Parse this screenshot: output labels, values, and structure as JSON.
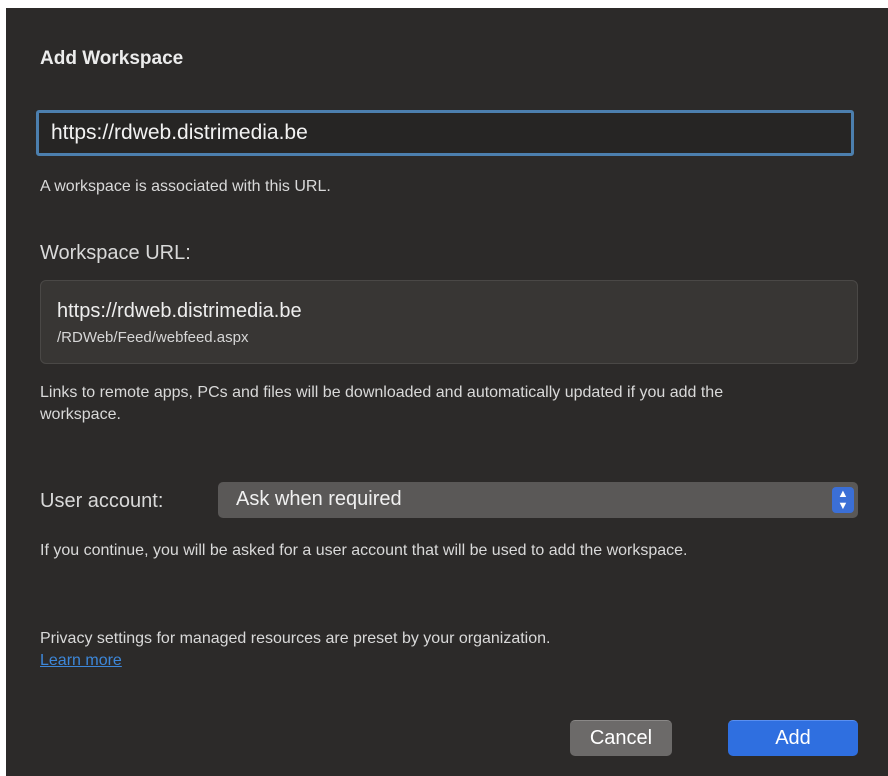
{
  "dialog": {
    "title": "Add Workspace",
    "url_input_value": "https://rdweb.distrimedia.be",
    "url_hint": "A workspace is associated with this URL.",
    "workspace_url_label": "Workspace URL:",
    "workspace_url": {
      "host": "https://rdweb.distrimedia.be",
      "path": "/RDWeb/Feed/webfeed.aspx"
    },
    "links_info": "Links to remote apps, PCs and files will be downloaded and automatically updated if you add the workspace.",
    "user_account": {
      "label": "User account:",
      "selected": "Ask when required",
      "arrow_icon": "updown-chevron-icon"
    },
    "account_info": "If you continue, you will be asked for a user account that will be used to add the workspace.",
    "privacy_info": "Privacy settings for managed resources are preset by your organization.",
    "learn_more": "Learn more",
    "buttons": {
      "cancel": "Cancel",
      "add": "Add"
    }
  },
  "colors": {
    "background": "#2c2a29",
    "focus_ring": "#4c7fae",
    "accent": "#2f6fe0",
    "link": "#3d87d9"
  }
}
